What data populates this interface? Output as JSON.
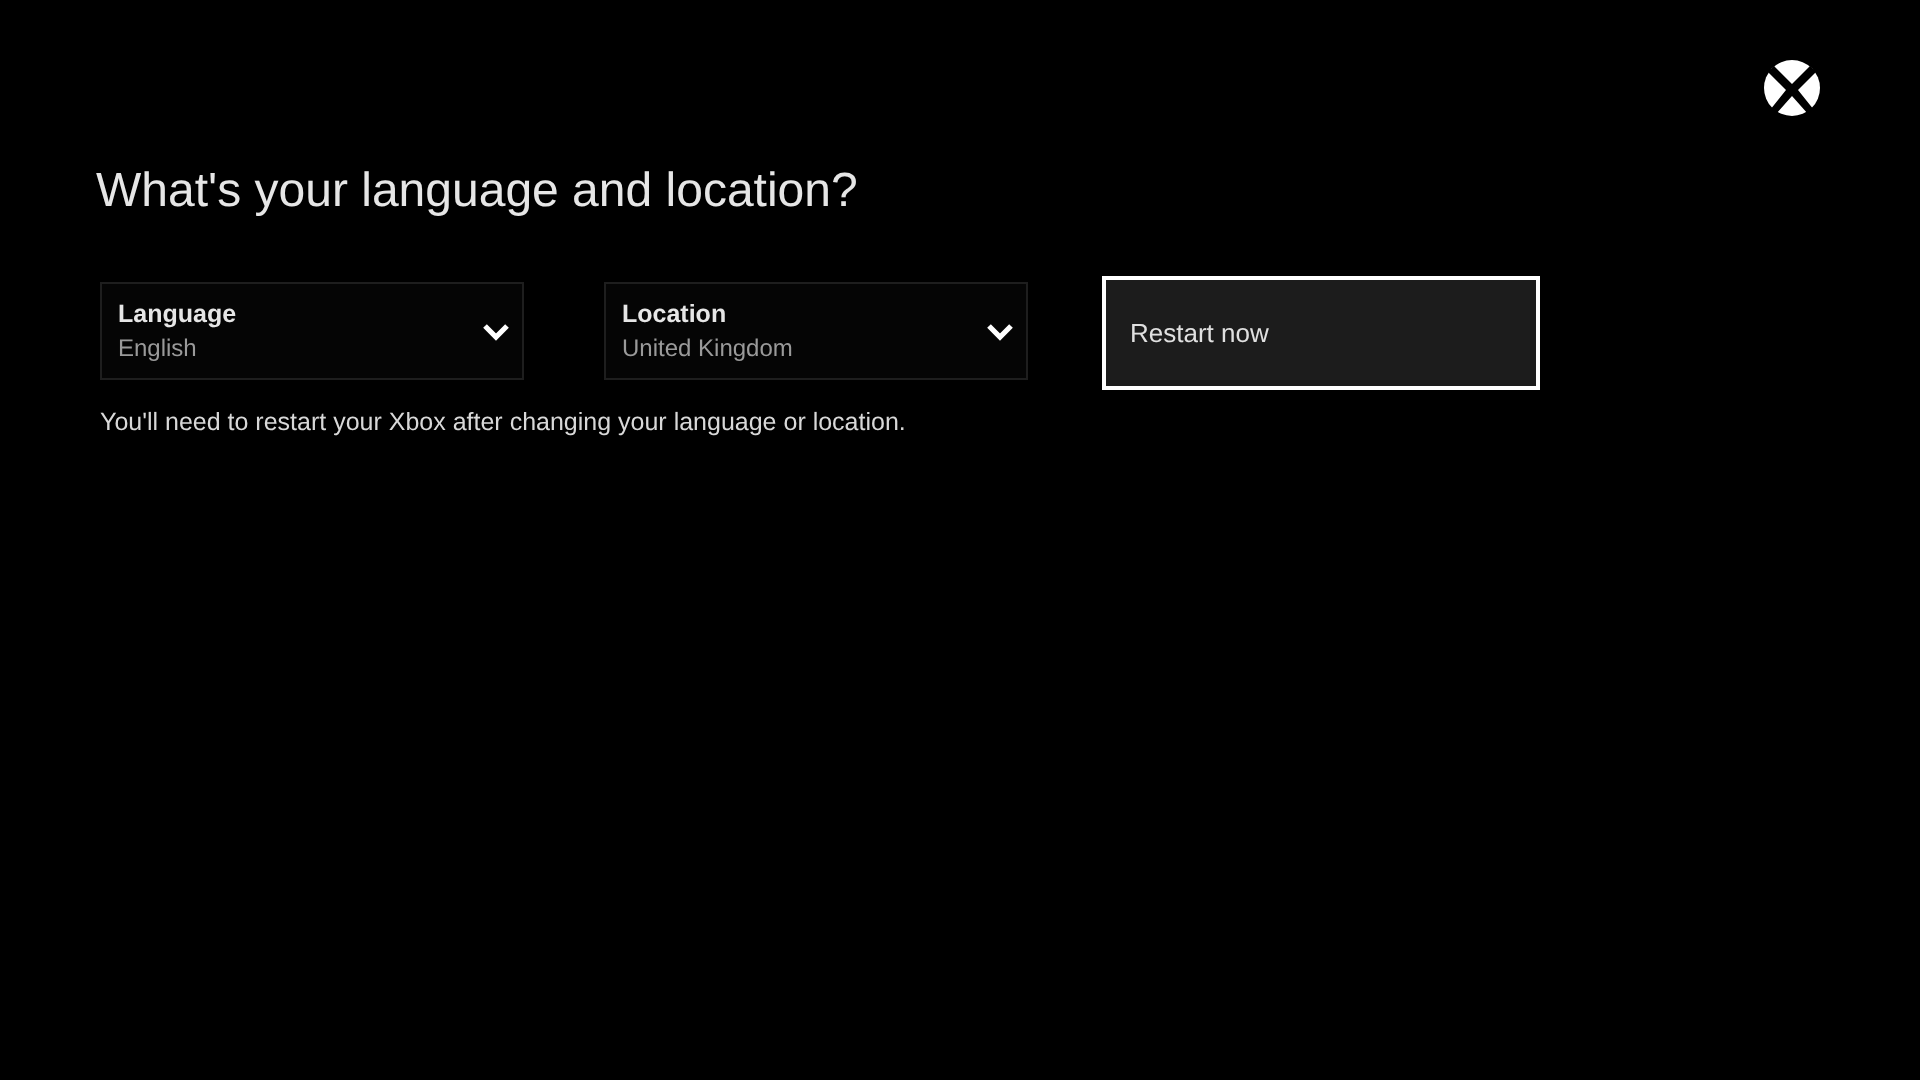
{
  "title": "What's your language and location?",
  "dropdowns": [
    {
      "label": "Language",
      "value": "English"
    },
    {
      "label": "Location",
      "value": "United Kingdom"
    }
  ],
  "button": {
    "label": "Restart now",
    "focused": true
  },
  "note": "You'll need to restart your Xbox after changing your language or location."
}
